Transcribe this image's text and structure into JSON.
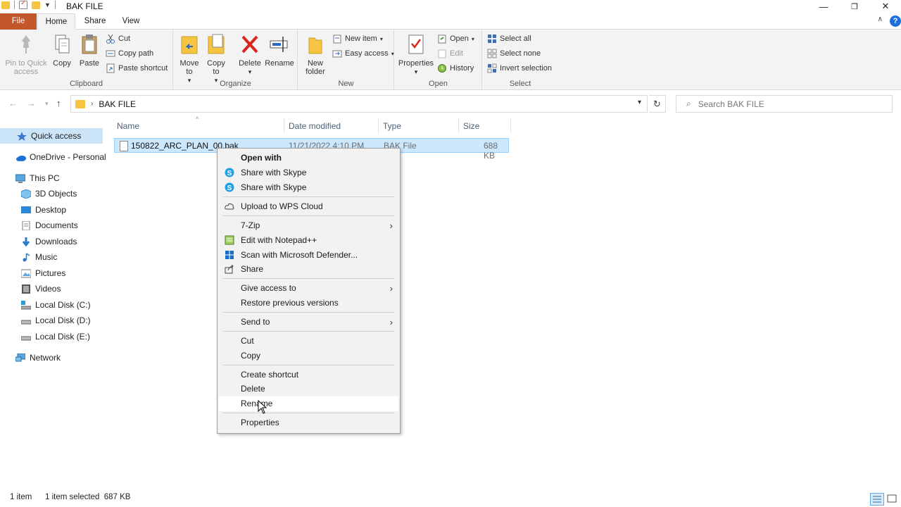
{
  "window": {
    "title": "BAK FILE",
    "controls": {
      "minimize": "—",
      "restore": "❐",
      "close": "✕"
    }
  },
  "ribbon_tabs": [
    "File",
    "Home",
    "Share",
    "View"
  ],
  "help_label": "?",
  "ribbon": {
    "clipboard": {
      "label": "Clipboard",
      "pin": "Pin to Quick access",
      "copy": "Copy",
      "paste": "Paste",
      "cut": "Cut",
      "copy_path": "Copy path",
      "paste_shortcut": "Paste shortcut"
    },
    "organize": {
      "label": "Organize",
      "move_to": "Move to",
      "copy_to": "Copy to",
      "delete": "Delete",
      "rename": "Rename"
    },
    "new": {
      "label": "New",
      "new_folder": "New folder",
      "new_item": "New item",
      "easy_access": "Easy access"
    },
    "open": {
      "label": "Open",
      "properties": "Properties",
      "open": "Open",
      "edit": "Edit",
      "history": "History"
    },
    "select": {
      "label": "Select",
      "select_all": "Select all",
      "select_none": "Select none",
      "invert_selection": "Invert selection"
    }
  },
  "address": {
    "path": "BAK FILE",
    "search_placeholder": "Search BAK FILE"
  },
  "sidebar": [
    {
      "label": "Quick access",
      "icon": "star-icon",
      "selected": true
    },
    {
      "label": "OneDrive - Personal",
      "icon": "cloud-icon"
    },
    {
      "label": "This PC",
      "icon": "computer-icon"
    },
    {
      "label": "3D Objects",
      "icon": "cube-icon"
    },
    {
      "label": "Desktop",
      "icon": "desktop-icon"
    },
    {
      "label": "Documents",
      "icon": "document-icon"
    },
    {
      "label": "Downloads",
      "icon": "download-icon"
    },
    {
      "label": "Music",
      "icon": "music-icon"
    },
    {
      "label": "Pictures",
      "icon": "picture-icon"
    },
    {
      "label": "Videos",
      "icon": "video-icon"
    },
    {
      "label": "Local Disk (C:)",
      "icon": "drive-icon"
    },
    {
      "label": "Local Disk (D:)",
      "icon": "drive-icon"
    },
    {
      "label": "Local Disk (E:)",
      "icon": "drive-icon"
    },
    {
      "label": "Network",
      "icon": "network-icon"
    }
  ],
  "columns": [
    "Name",
    "Date modified",
    "Type",
    "Size"
  ],
  "files": [
    {
      "name": "150822_ARC_PLAN_00.bak",
      "date": "11/21/2022 4:10 PM",
      "type": "BAK File",
      "size": "688 KB"
    }
  ],
  "context_menu": {
    "open_with": "Open with",
    "share_skype_1": "Share with Skype",
    "share_skype_2": "Share with Skype",
    "upload_wps": "Upload to WPS Cloud",
    "seven_zip": "7-Zip",
    "edit_notepad": "Edit with Notepad++",
    "scan_defender": "Scan with Microsoft Defender...",
    "share": "Share",
    "give_access": "Give access to",
    "restore_versions": "Restore previous versions",
    "send_to": "Send to",
    "cut": "Cut",
    "copy": "Copy",
    "create_shortcut": "Create shortcut",
    "delete": "Delete",
    "rename": "Rename",
    "properties": "Properties"
  },
  "status": {
    "count": "1 item",
    "selected": "1 item selected  687 KB"
  },
  "colors": {
    "file_tab": "#c1572a",
    "selection": "#cce8ff",
    "accent": "#1e6fd9"
  }
}
